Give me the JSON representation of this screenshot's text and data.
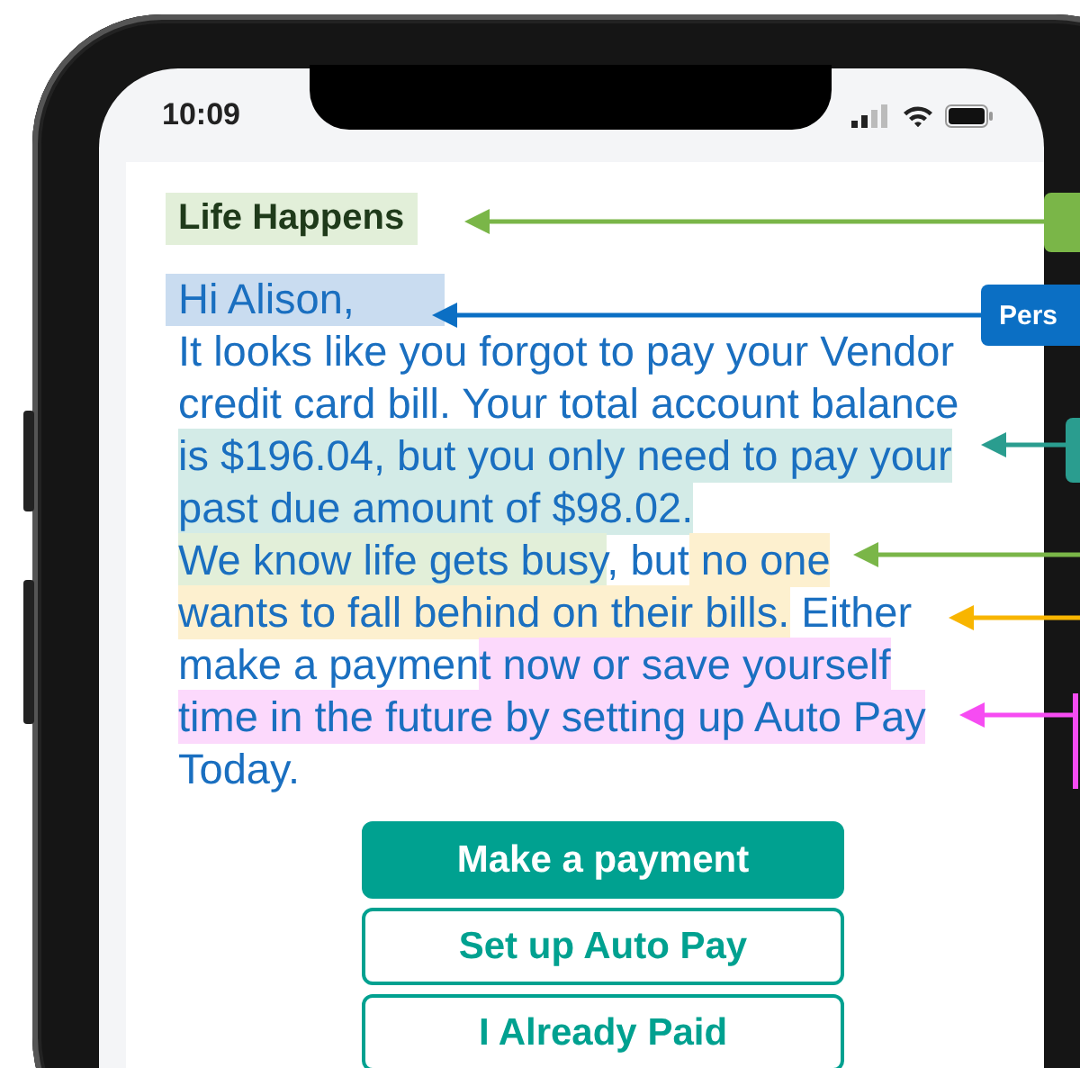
{
  "status_bar": {
    "time": "10:09"
  },
  "title": "Life Happens",
  "greeting": {
    "text": "Hi Alison,",
    "color": "#c9dcf0"
  },
  "message_lines": [
    [
      {
        "text": "It looks like you forgot to pay your Vendor"
      }
    ],
    [
      {
        "text": "credit card bill. Your total account balance"
      }
    ],
    [
      {
        "text": "is $196.04, but you only need to pay your",
        "color": "#d3ebe7"
      }
    ],
    [
      {
        "text": "past due amount of $98.02.",
        "color": "#d3ebe7"
      }
    ],
    [
      {
        "text": "We know life gets busy",
        "color": "#e2efd9"
      },
      {
        "text": ", but"
      },
      {
        "text": " no one",
        "color": "#fdf0cf"
      }
    ],
    [
      {
        "text": "wants to fall behind on their bills.",
        "color": "#fdf0cf"
      },
      {
        "text": " Either"
      }
    ],
    [
      {
        "text": "make a paymen"
      },
      {
        "text": "t now or save yourself",
        "color": "#fcd9fc"
      }
    ],
    [
      {
        "text": "time in the future by setting up Auto Pay",
        "color": "#fcd9fc"
      }
    ],
    [
      {
        "text": "Today."
      }
    ]
  ],
  "buttons": [
    {
      "label": "Make a payment",
      "kind": "primary"
    },
    {
      "label": "Set up Auto Pay",
      "kind": "outline"
    },
    {
      "label": "I Already Paid",
      "kind": "outline"
    }
  ],
  "annotations": [
    {
      "kind": "tag",
      "color": "#7ab648"
    },
    {
      "kind": "tag",
      "color": "#0b6fc4",
      "label": "Pers"
    },
    {
      "kind": "tag",
      "color": "#2a9d8f"
    },
    {
      "kind": "arrow",
      "color": "#7ab648"
    },
    {
      "kind": "arrow",
      "color": "#f8b500"
    },
    {
      "kind": "bracket",
      "color": "#f64cf2"
    }
  ]
}
